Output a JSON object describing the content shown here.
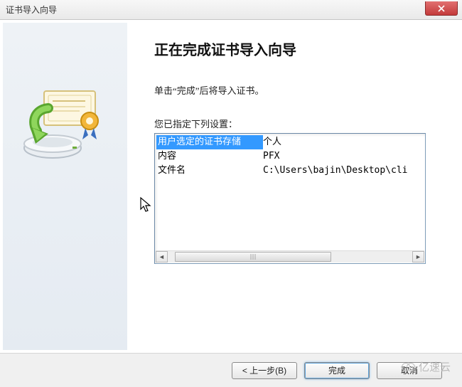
{
  "window": {
    "title": "证书导入向导"
  },
  "main": {
    "heading": "正在完成证书导入向导",
    "instruction": "单击“完成”后将导入证书。",
    "settings_label": "您已指定下列设置：",
    "rows": [
      {
        "k": "用户选定的证书存储",
        "v": "个人"
      },
      {
        "k": "内容",
        "v": "PFX"
      },
      {
        "k": "文件名",
        "v": "C:\\Users\\bajin\\Desktop\\cli"
      }
    ]
  },
  "buttons": {
    "back": "< 上一步(B)",
    "finish": "完成",
    "cancel": "取消"
  },
  "watermark": "亿速云"
}
